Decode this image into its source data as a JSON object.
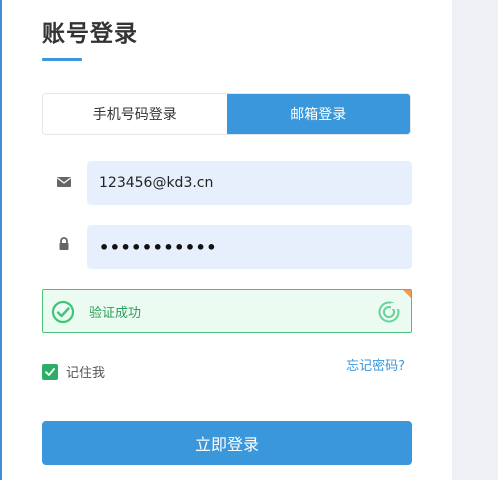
{
  "page": {
    "title": "账号登录"
  },
  "tabs": [
    {
      "label": "手机号码登录",
      "active": false
    },
    {
      "label": "邮箱登录",
      "active": true
    }
  ],
  "form": {
    "email_value": "123456@kd3.cn",
    "email_icon": "envelope-icon",
    "password_value": "•••••••••••",
    "password_icon": "lock-icon"
  },
  "captcha": {
    "status_text": "验证成功",
    "status_icon": "check-circle-icon",
    "brand_icon": "captcha-logo-icon"
  },
  "remember": {
    "label": "记住我",
    "checked": true
  },
  "forgot_label": "忘记密码?",
  "submit_label": "立即登录",
  "colors": {
    "primary": "#3a97dc",
    "success": "#2dae67",
    "input_bg": "#e8effc",
    "panel_bg": "#eef0f5"
  }
}
